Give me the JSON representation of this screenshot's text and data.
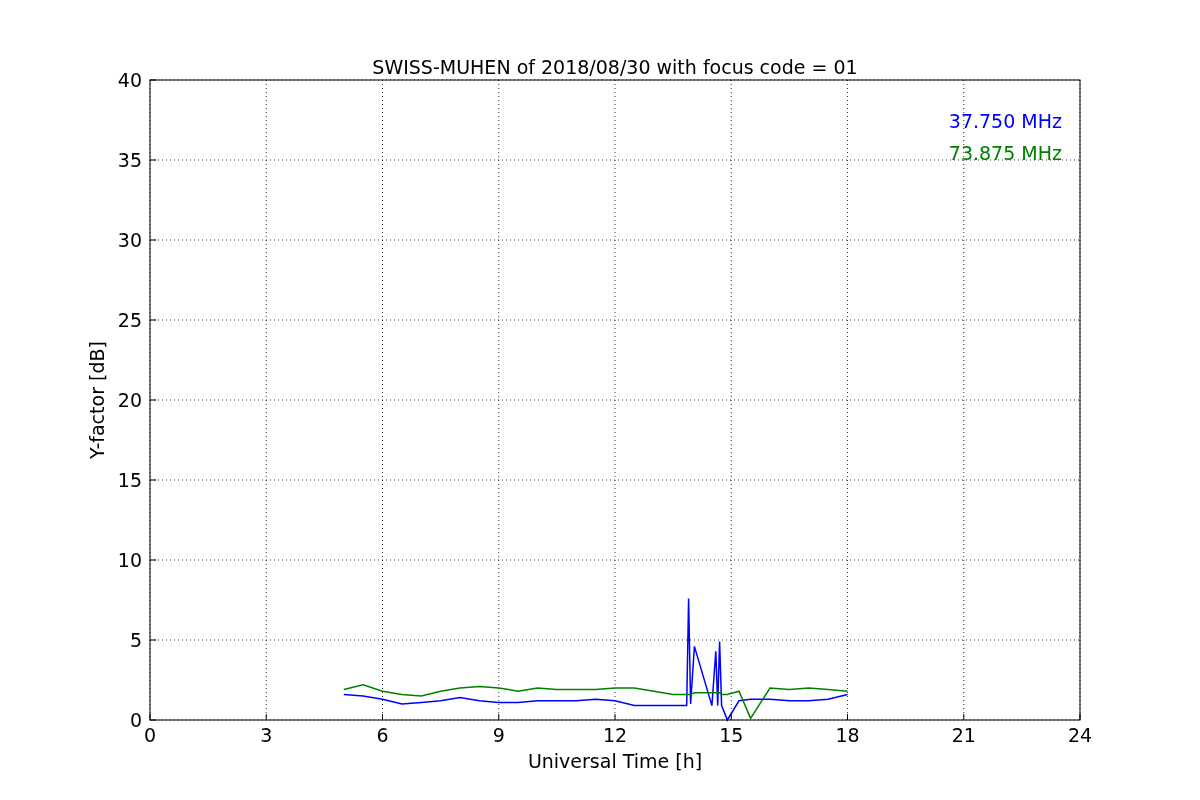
{
  "chart_data": {
    "type": "line",
    "title": "SWISS-MUHEN of 2018/08/30 with focus code = 01",
    "xlabel": "Universal Time [h]",
    "ylabel": "Y-factor [dB]",
    "x": [
      5,
      5.5,
      6,
      6.5,
      7,
      7.5,
      8,
      8.5,
      9,
      9.5,
      10,
      10.5,
      11,
      11.5,
      12,
      12.5,
      13,
      13.5,
      13.85,
      13.9,
      13.95,
      14.05,
      14.5,
      14.6,
      14.65,
      14.7,
      14.75,
      14.9,
      15.2,
      15.5,
      16,
      16.5,
      17,
      17.5,
      18
    ],
    "series": [
      {
        "name": "37.750 MHz",
        "color": "#0000ff",
        "values": [
          1.6,
          1.5,
          1.3,
          1.0,
          1.1,
          1.2,
          1.4,
          1.2,
          1.1,
          1.1,
          1.2,
          1.2,
          1.2,
          1.3,
          1.2,
          0.9,
          0.9,
          0.9,
          0.9,
          7.6,
          1.0,
          4.6,
          0.9,
          4.3,
          0.9,
          4.9,
          0.9,
          0.0,
          1.2,
          1.3,
          1.3,
          1.2,
          1.2,
          1.3,
          1.6
        ]
      },
      {
        "name": "73.875 MHz",
        "color": "#008000",
        "values": [
          1.9,
          2.2,
          1.8,
          1.6,
          1.5,
          1.8,
          2.0,
          2.1,
          2.0,
          1.8,
          2.0,
          1.9,
          1.9,
          1.9,
          2.0,
          2.0,
          1.8,
          1.6,
          1.6,
          1.6,
          1.6,
          1.7,
          1.7,
          1.7,
          1.7,
          1.7,
          1.6,
          1.6,
          1.8,
          0.1,
          2.0,
          1.9,
          2.0,
          1.9,
          1.8
        ]
      }
    ],
    "xlim": [
      0,
      24
    ],
    "ylim": [
      0,
      40
    ],
    "xticks": [
      0,
      3,
      6,
      9,
      12,
      15,
      18,
      21,
      24
    ],
    "yticks": [
      0,
      5,
      10,
      15,
      20,
      25,
      30,
      35,
      40
    ],
    "grid": true
  }
}
